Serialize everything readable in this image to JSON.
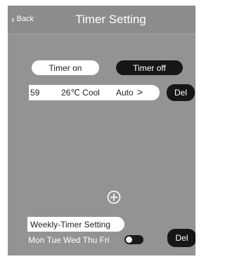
{
  "header": {
    "back_label": "Back",
    "title": "Timer Setting"
  },
  "tabs": {
    "timer_on": "Timer on",
    "timer_off": "Timer off"
  },
  "timer_entry": {
    "time": "59",
    "temperature_mode": "26℃ Cool",
    "fan": "Auto",
    "arrow": ">"
  },
  "delete_label": "Del",
  "weekly": {
    "label": "Weekly-Timer Setting",
    "days": "Mon Tue Wed Thu Fri",
    "toggle_state": "on"
  },
  "colors": {
    "panel": "#939393",
    "dark_button": "#161616",
    "light_button": "#ffffff"
  }
}
